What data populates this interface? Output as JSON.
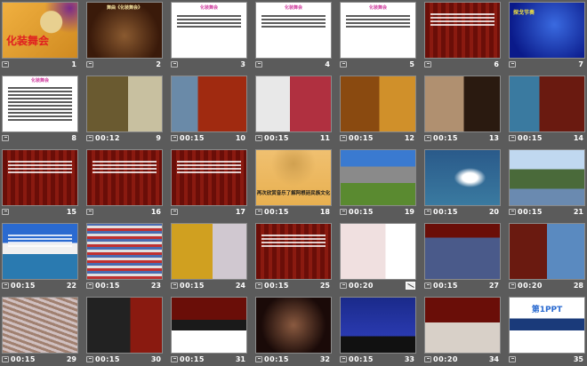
{
  "view": "slide-sorter",
  "slides": [
    {
      "number": "1",
      "time": "",
      "title": "化装舞会"
    },
    {
      "number": "2",
      "time": "",
      "title": "舞曲《化装舞会》"
    },
    {
      "number": "3",
      "time": "",
      "title": "化装舞会"
    },
    {
      "number": "4",
      "time": "",
      "title": "化装舞会"
    },
    {
      "number": "5",
      "time": "",
      "title": "化装舞会"
    },
    {
      "number": "6",
      "time": "",
      "title": ""
    },
    {
      "number": "7",
      "time": "",
      "title": "探戈节奏"
    },
    {
      "number": "8",
      "time": "",
      "title": "化装舞会"
    },
    {
      "number": "9",
      "time": "00:12",
      "title": ""
    },
    {
      "number": "10",
      "time": "00:15",
      "title": ""
    },
    {
      "number": "11",
      "time": "00:15",
      "title": ""
    },
    {
      "number": "12",
      "time": "00:15",
      "title": ""
    },
    {
      "number": "13",
      "time": "00:15",
      "title": ""
    },
    {
      "number": "14",
      "time": "00:15",
      "title": ""
    },
    {
      "number": "15",
      "time": "",
      "title": ""
    },
    {
      "number": "16",
      "time": "",
      "title": ""
    },
    {
      "number": "17",
      "time": "",
      "title": ""
    },
    {
      "number": "18",
      "time": "00:15",
      "title": "再次欣赏音乐了解阿根廷民族文化"
    },
    {
      "number": "19",
      "time": "00:15",
      "title": ""
    },
    {
      "number": "20",
      "time": "00:15",
      "title": ""
    },
    {
      "number": "21",
      "time": "00:15",
      "title": ""
    },
    {
      "number": "22",
      "time": "00:15",
      "title": ""
    },
    {
      "number": "23",
      "time": "00:15",
      "title": ""
    },
    {
      "number": "24",
      "time": "00:15",
      "title": ""
    },
    {
      "number": "25",
      "time": "00:15",
      "title": ""
    },
    {
      "number": "",
      "time": "00:20",
      "title": "",
      "hidden": true
    },
    {
      "number": "27",
      "time": "00:15",
      "title": ""
    },
    {
      "number": "28",
      "time": "00:20",
      "title": ""
    },
    {
      "number": "29",
      "time": "00:15",
      "title": ""
    },
    {
      "number": "30",
      "time": "00:15",
      "title": ""
    },
    {
      "number": "31",
      "time": "00:15",
      "title": ""
    },
    {
      "number": "32",
      "time": "00:15",
      "title": ""
    },
    {
      "number": "33",
      "time": "00:15",
      "title": ""
    },
    {
      "number": "34",
      "time": "00:20",
      "title": ""
    },
    {
      "number": "35",
      "time": "",
      "title": "第1PPT"
    }
  ]
}
